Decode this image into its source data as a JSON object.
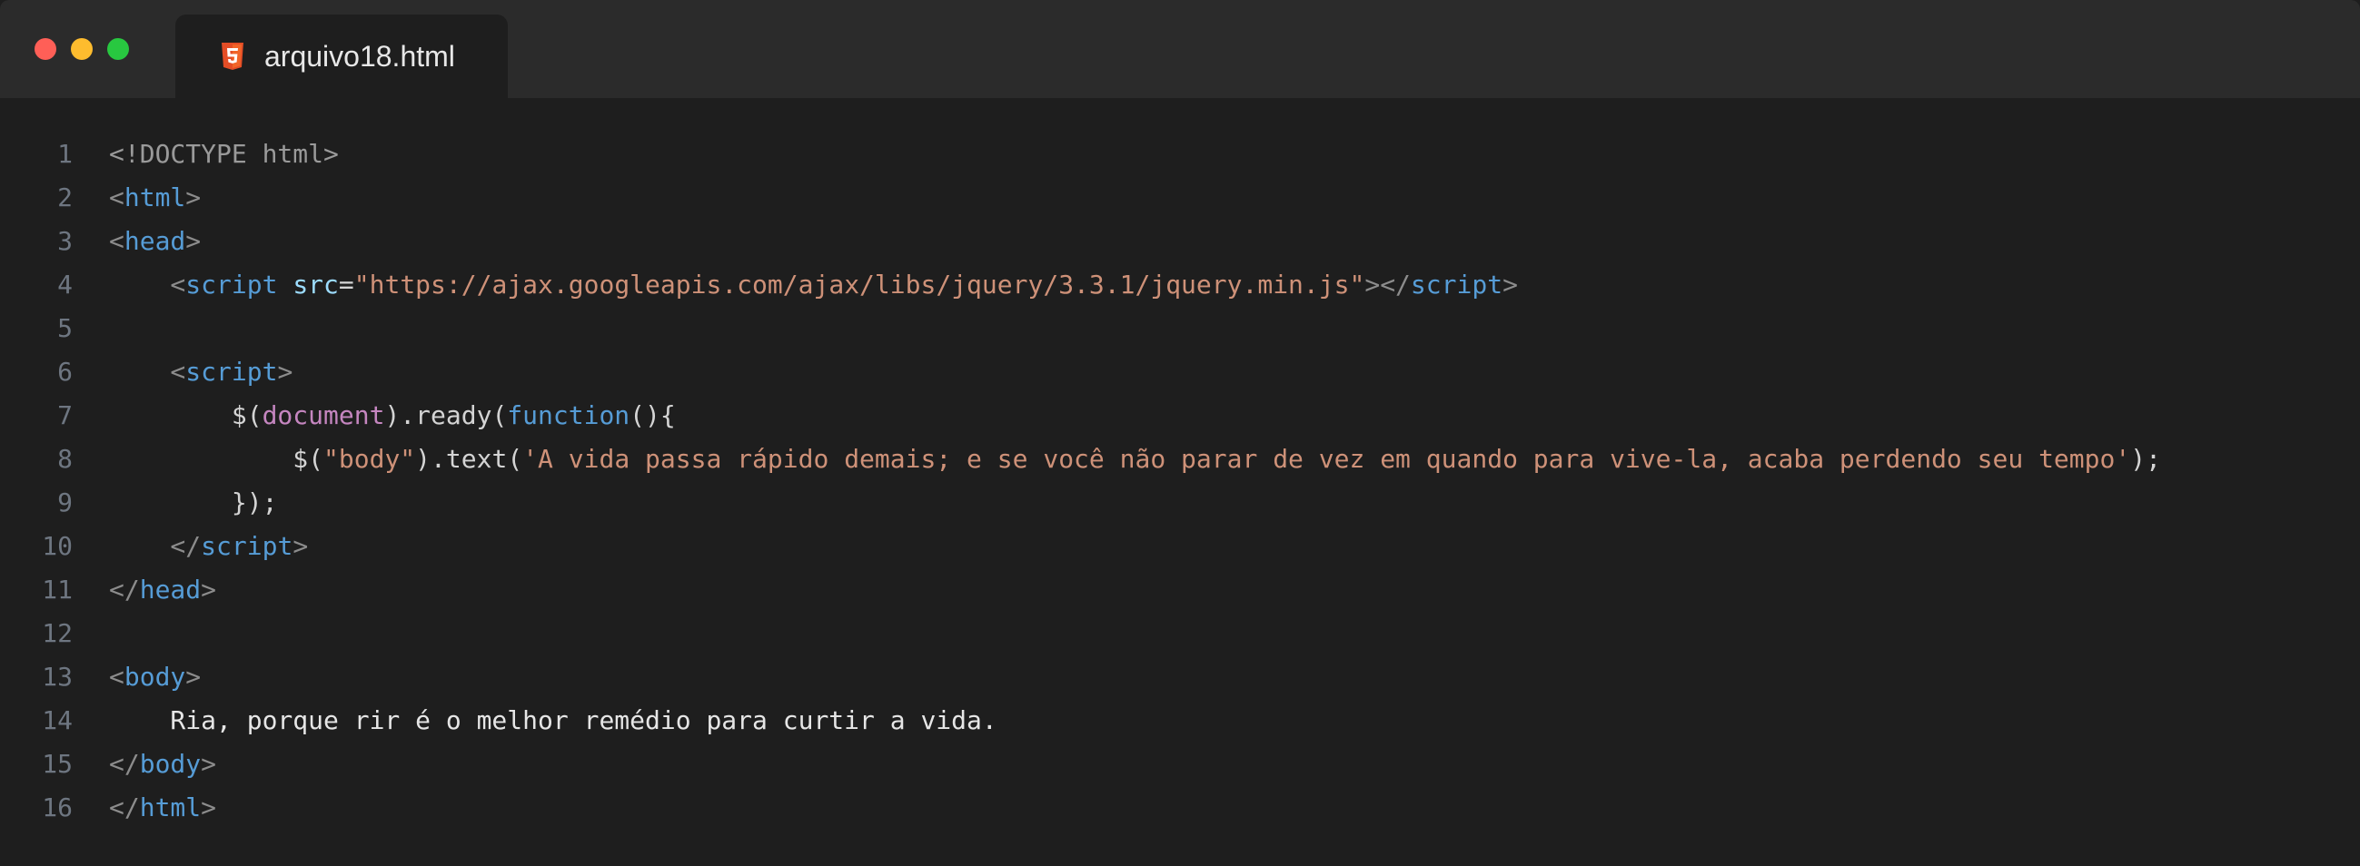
{
  "window": {
    "traffic_lights": [
      "close",
      "minimize",
      "maximize"
    ]
  },
  "tab": {
    "icon": "html5-icon",
    "label": "arquivo18.html"
  },
  "colors": {
    "background": "#1e1e1e",
    "titlebar": "#2b2b2b",
    "tag": "#569cd6",
    "string": "#ce9178",
    "attribute": "#9cdcfe",
    "object": "#c586c0",
    "line_number": "#6e7681"
  },
  "editor": {
    "lines": [
      {
        "num": "1",
        "segments": [
          {
            "t": "<!DOCTYPE html>",
            "c": "doctype"
          }
        ]
      },
      {
        "num": "2",
        "segments": [
          {
            "t": "<",
            "c": "punct"
          },
          {
            "t": "html",
            "c": "tag"
          },
          {
            "t": ">",
            "c": "punct"
          }
        ]
      },
      {
        "num": "3",
        "segments": [
          {
            "t": "<",
            "c": "punct"
          },
          {
            "t": "head",
            "c": "tag"
          },
          {
            "t": ">",
            "c": "punct"
          }
        ]
      },
      {
        "num": "4",
        "segments": [
          {
            "t": "    <",
            "c": "punct"
          },
          {
            "t": "script",
            "c": "tag"
          },
          {
            "t": " ",
            "c": "plain"
          },
          {
            "t": "src",
            "c": "attr"
          },
          {
            "t": "=",
            "c": "plain"
          },
          {
            "t": "\"https://ajax.googleapis.com/ajax/libs/jquery/3.3.1/jquery.min.js\"",
            "c": "str"
          },
          {
            "t": "></",
            "c": "punct"
          },
          {
            "t": "script",
            "c": "tag"
          },
          {
            "t": ">",
            "c": "punct"
          }
        ]
      },
      {
        "num": "5",
        "segments": []
      },
      {
        "num": "6",
        "segments": [
          {
            "t": "    <",
            "c": "punct"
          },
          {
            "t": "script",
            "c": "tag"
          },
          {
            "t": ">",
            "c": "punct"
          }
        ]
      },
      {
        "num": "7",
        "segments": [
          {
            "t": "        $(",
            "c": "plain"
          },
          {
            "t": "document",
            "c": "obj"
          },
          {
            "t": ").ready(",
            "c": "plain"
          },
          {
            "t": "function",
            "c": "kw"
          },
          {
            "t": "(){",
            "c": "plain"
          }
        ]
      },
      {
        "num": "8",
        "segments": [
          {
            "t": "            $(",
            "c": "plain"
          },
          {
            "t": "\"body\"",
            "c": "str"
          },
          {
            "t": ").text(",
            "c": "plain"
          },
          {
            "t": "'A vida passa rápido demais; e se você não parar de vez em quando para vive-la, acaba perdendo seu tempo'",
            "c": "str"
          },
          {
            "t": ");",
            "c": "plain"
          }
        ]
      },
      {
        "num": "9",
        "segments": [
          {
            "t": "        });",
            "c": "plain"
          }
        ]
      },
      {
        "num": "10",
        "segments": [
          {
            "t": "    </",
            "c": "punct"
          },
          {
            "t": "script",
            "c": "tag"
          },
          {
            "t": ">",
            "c": "punct"
          }
        ]
      },
      {
        "num": "11",
        "segments": [
          {
            "t": "</",
            "c": "punct"
          },
          {
            "t": "head",
            "c": "tag"
          },
          {
            "t": ">",
            "c": "punct"
          }
        ]
      },
      {
        "num": "12",
        "segments": []
      },
      {
        "num": "13",
        "segments": [
          {
            "t": "<",
            "c": "punct"
          },
          {
            "t": "body",
            "c": "tag"
          },
          {
            "t": ">",
            "c": "punct"
          }
        ]
      },
      {
        "num": "14",
        "segments": [
          {
            "t": "    Ria, porque rir é o melhor remédio para curtir a vida.",
            "c": "text"
          }
        ]
      },
      {
        "num": "15",
        "segments": [
          {
            "t": "</",
            "c": "punct"
          },
          {
            "t": "body",
            "c": "tag"
          },
          {
            "t": ">",
            "c": "punct"
          }
        ]
      },
      {
        "num": "16",
        "segments": [
          {
            "t": "</",
            "c": "punct"
          },
          {
            "t": "html",
            "c": "tag"
          },
          {
            "t": ">",
            "c": "punct"
          }
        ]
      }
    ]
  }
}
